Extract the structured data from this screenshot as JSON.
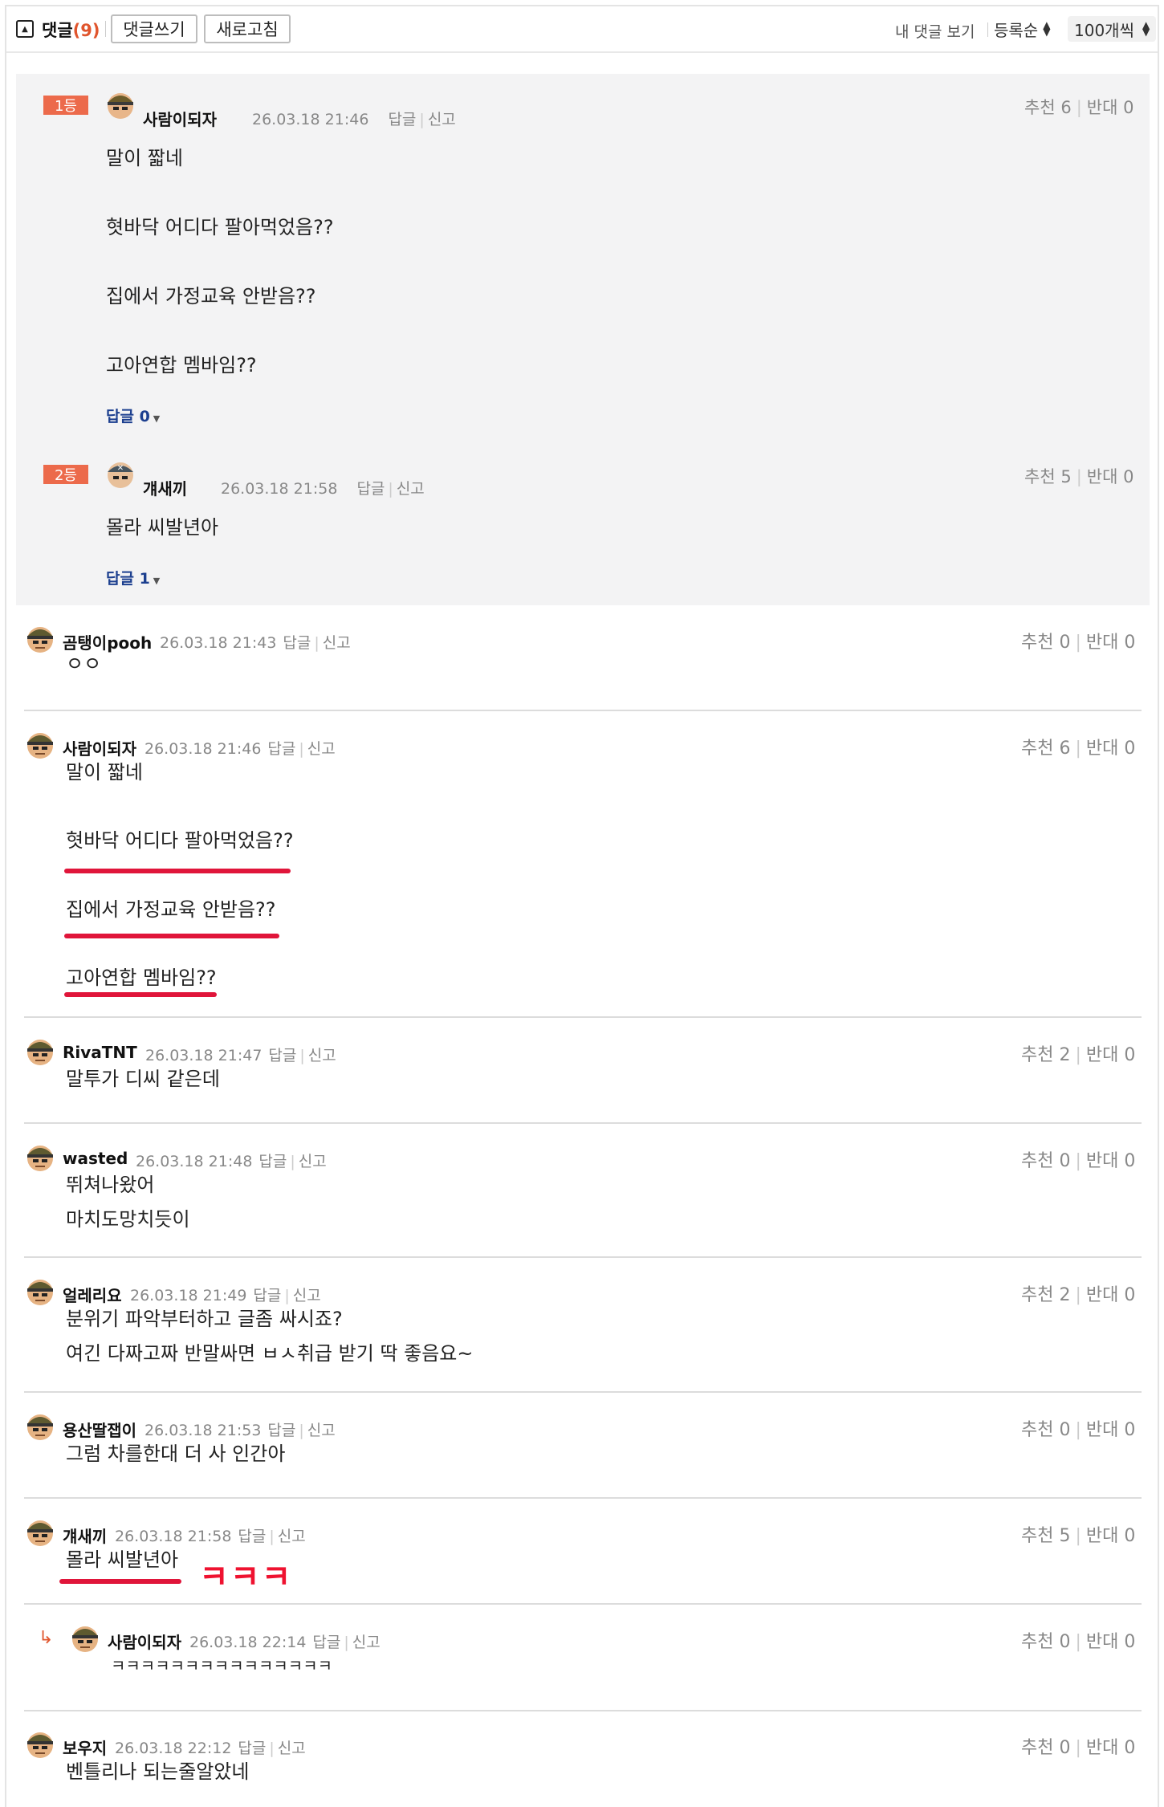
{
  "header": {
    "title": "댓글",
    "count": "(9)",
    "write_button": "댓글쓰기",
    "refresh_button": "새로고침",
    "my_comments": "내 댓글 보기",
    "sort": "등록순",
    "per_page": "100개씩"
  },
  "best": [
    {
      "rank": "1등",
      "name": "사람이되자",
      "time": "26.03.18 21:46",
      "reply": "답글",
      "report": "신고",
      "up": "추천 6",
      "down": "반대 0",
      "lines": [
        "말이 짧네",
        "혓바닥 어디다 팔아먹었음??",
        "집에서 가정교육 안받음??",
        "고아연합 멤바임??"
      ],
      "replies": "답글 0"
    },
    {
      "rank": "2등",
      "name": "걔새끼",
      "time": "26.03.18 21:58",
      "reply": "답글",
      "report": "신고",
      "up": "추천 5",
      "down": "반대 0",
      "lines": [
        "몰라 씨발년아"
      ],
      "replies": "답글 1"
    }
  ],
  "comments": [
    {
      "name": "곰탱이pooh",
      "time": "26.03.18 21:43",
      "reply": "답글",
      "report": "신고",
      "up": "추천 0",
      "down": "반대 0",
      "lines": [
        "ㅇㅇ"
      ]
    },
    {
      "name": "사람이되자",
      "time": "26.03.18 21:46",
      "reply": "답글",
      "report": "신고",
      "up": "추천 6",
      "down": "반대 0",
      "lines": [
        "말이 짧네",
        "혓바닥 어디다 팔아먹었음??",
        "집에서 가정교육 안받음??",
        "고아연합 멤바임??"
      ]
    },
    {
      "name": "RivaTNT",
      "time": "26.03.18 21:47",
      "reply": "답글",
      "report": "신고",
      "up": "추천 2",
      "down": "반대 0",
      "lines": [
        "말투가 디씨 같은데"
      ]
    },
    {
      "name": "wasted",
      "time": "26.03.18 21:48",
      "reply": "답글",
      "report": "신고",
      "up": "추천 0",
      "down": "반대 0",
      "lines": [
        "뛰쳐나왔어",
        "마치도망치듯이"
      ]
    },
    {
      "name": "얼레리요",
      "time": "26.03.18 21:49",
      "reply": "답글",
      "report": "신고",
      "up": "추천 2",
      "down": "반대 0",
      "lines": [
        "분위기 파악부터하고 글좀 싸시죠?",
        "여긴 다짜고짜 반말싸면 ㅂㅅ취급 받기 딱 좋음요~"
      ]
    },
    {
      "name": "용산딸잽이",
      "time": "26.03.18 21:53",
      "reply": "답글",
      "report": "신고",
      "up": "추천 0",
      "down": "반대 0",
      "lines": [
        "그럼 차를한대 더 사 인간아"
      ]
    },
    {
      "name": "걔새끼",
      "time": "26.03.18 21:58",
      "reply": "답글",
      "report": "신고",
      "up": "추천 5",
      "down": "반대 0",
      "lines": [
        "몰라 씨발년아"
      ]
    },
    {
      "name": "사람이되자",
      "time": "26.03.18 22:14",
      "reply": "답글",
      "report": "신고",
      "up": "추천 0",
      "down": "반대 0",
      "lines": [
        "ㅋㅋㅋㅋㅋㅋㅋㅋㅋㅋㅋㅋㅋㅋㅋ"
      ]
    },
    {
      "name": "보우지",
      "time": "26.03.18 22:12",
      "reply": "답글",
      "report": "신고",
      "up": "추천 0",
      "down": "반대 0",
      "lines": [
        "벤틀리나 되는줄알았네"
      ]
    }
  ],
  "annotation": "ㅋㅋㅋ",
  "colors": {
    "accent": "#e0552d",
    "rank_badge": "#ec6a4b",
    "underline": "#e0153a",
    "reply_count": "#1c3f8f",
    "best_bg": "#f3f3f4"
  }
}
